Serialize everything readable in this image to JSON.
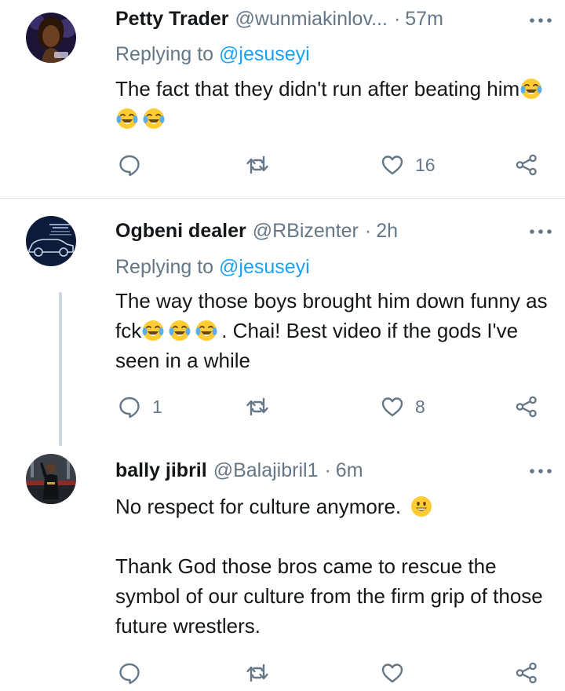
{
  "tweets": [
    {
      "name": "Petty Trader",
      "handle": "@wunmiakinlov...",
      "separator": "·",
      "time": "57m",
      "replying_prefix": "Replying to ",
      "replying_to": "@jesuseyi",
      "text": "The fact that they didn't run after beating him",
      "reply_count": "",
      "like_count": "16"
    },
    {
      "name": "Ogbeni dealer",
      "handle": "@RBizenter",
      "separator": "·",
      "time": "2h",
      "replying_prefix": "Replying to ",
      "replying_to": "@jesuseyi",
      "text_part1": "The way those boys brought him down funny as fck",
      "text_part2": ".  Chai! Best video if the gods I've seen in a while",
      "reply_count": "1",
      "like_count": "8"
    },
    {
      "name": "bally jibril",
      "handle": "@Balajibril1",
      "separator": "·",
      "time": "6m",
      "text_line1": "No respect for culture anymore.",
      "text_para2": "Thank God those bros came to rescue the symbol of our culture from the firm grip of those future wrestlers.",
      "reply_count": "",
      "like_count": ""
    }
  ],
  "colors": {
    "secondary_text": "#657786",
    "link": "#1da1f2",
    "divider": "#e1e8ed",
    "thread_line": "#ccd6dd"
  },
  "icons": [
    "more-icon",
    "reply-icon",
    "retweet-icon",
    "like-icon",
    "share-icon",
    "tears-of-joy-emoji",
    "grinning-emoji"
  ]
}
